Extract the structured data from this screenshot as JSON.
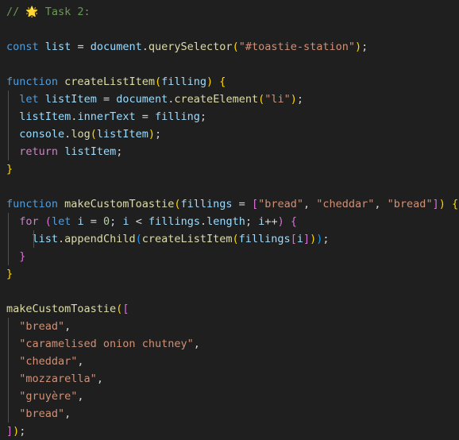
{
  "editor": {
    "language": "javascript",
    "theme": "dark-plus",
    "background_color": "#1f1f1f",
    "colors": {
      "comment": "#6a9955",
      "keyword": "#569cd6",
      "control": "#c586c0",
      "variable": "#9cdcfe",
      "function": "#dcdcaa",
      "string": "#ce9178",
      "number": "#b5cea8",
      "operator": "#d4d4d4",
      "bracket_level_1": "#ffd700",
      "bracket_level_2": "#da70d6",
      "bracket_level_3": "#179fff",
      "indent_guide": "#505050"
    }
  },
  "code": {
    "lines": [
      {
        "n": 1,
        "text": "// 🌟 Task 2:",
        "tokens": [
          {
            "t": "// ",
            "c": "cmt"
          },
          {
            "t": "🌟",
            "c": "star"
          },
          {
            "t": " Task 2:",
            "c": "cmt"
          }
        ]
      },
      {
        "n": 2,
        "text": "",
        "tokens": []
      },
      {
        "n": 3,
        "text": "const list = document.querySelector(\"#toastie-station\");",
        "tokens": [
          {
            "t": "const",
            "c": "kw"
          },
          {
            "t": " ",
            "c": "plain"
          },
          {
            "t": "list",
            "c": "var"
          },
          {
            "t": " ",
            "c": "plain"
          },
          {
            "t": "=",
            "c": "op"
          },
          {
            "t": " ",
            "c": "plain"
          },
          {
            "t": "document",
            "c": "var"
          },
          {
            "t": ".",
            "c": "op"
          },
          {
            "t": "querySelector",
            "c": "fn"
          },
          {
            "t": "(",
            "c": "b1"
          },
          {
            "t": "\"#toastie-station\"",
            "c": "str"
          },
          {
            "t": ")",
            "c": "b1"
          },
          {
            "t": ";",
            "c": "op"
          }
        ]
      },
      {
        "n": 4,
        "text": "",
        "tokens": []
      },
      {
        "n": 5,
        "text": "function createListItem(filling) {",
        "tokens": [
          {
            "t": "function",
            "c": "kw"
          },
          {
            "t": " ",
            "c": "plain"
          },
          {
            "t": "createListItem",
            "c": "fn"
          },
          {
            "t": "(",
            "c": "b1"
          },
          {
            "t": "filling",
            "c": "var"
          },
          {
            "t": ")",
            "c": "b1"
          },
          {
            "t": " ",
            "c": "plain"
          },
          {
            "t": "{",
            "c": "b1"
          }
        ]
      },
      {
        "n": 6,
        "indent": 1,
        "text": "  let listItem = document.createElement(\"li\");",
        "tokens": [
          {
            "t": "  ",
            "c": "plain"
          },
          {
            "t": "let",
            "c": "kw"
          },
          {
            "t": " ",
            "c": "plain"
          },
          {
            "t": "listItem",
            "c": "var"
          },
          {
            "t": " ",
            "c": "plain"
          },
          {
            "t": "=",
            "c": "op"
          },
          {
            "t": " ",
            "c": "plain"
          },
          {
            "t": "document",
            "c": "var"
          },
          {
            "t": ".",
            "c": "op"
          },
          {
            "t": "createElement",
            "c": "fn"
          },
          {
            "t": "(",
            "c": "b1"
          },
          {
            "t": "\"li\"",
            "c": "str"
          },
          {
            "t": ")",
            "c": "b1"
          },
          {
            "t": ";",
            "c": "op"
          }
        ]
      },
      {
        "n": 7,
        "indent": 1,
        "text": "  listItem.innerText = filling;",
        "tokens": [
          {
            "t": "  ",
            "c": "plain"
          },
          {
            "t": "listItem",
            "c": "var"
          },
          {
            "t": ".",
            "c": "op"
          },
          {
            "t": "innerText",
            "c": "var"
          },
          {
            "t": " ",
            "c": "plain"
          },
          {
            "t": "=",
            "c": "op"
          },
          {
            "t": " ",
            "c": "plain"
          },
          {
            "t": "filling",
            "c": "var"
          },
          {
            "t": ";",
            "c": "op"
          }
        ]
      },
      {
        "n": 8,
        "indent": 1,
        "text": "  console.log(listItem);",
        "tokens": [
          {
            "t": "  ",
            "c": "plain"
          },
          {
            "t": "console",
            "c": "var"
          },
          {
            "t": ".",
            "c": "op"
          },
          {
            "t": "log",
            "c": "fn"
          },
          {
            "t": "(",
            "c": "b1"
          },
          {
            "t": "listItem",
            "c": "var"
          },
          {
            "t": ")",
            "c": "b1"
          },
          {
            "t": ";",
            "c": "op"
          }
        ]
      },
      {
        "n": 9,
        "indent": 1,
        "text": "  return listItem;",
        "tokens": [
          {
            "t": "  ",
            "c": "plain"
          },
          {
            "t": "return",
            "c": "ctl"
          },
          {
            "t": " ",
            "c": "plain"
          },
          {
            "t": "listItem",
            "c": "var"
          },
          {
            "t": ";",
            "c": "op"
          }
        ]
      },
      {
        "n": 10,
        "text": "}",
        "tokens": [
          {
            "t": "}",
            "c": "b1"
          }
        ]
      },
      {
        "n": 11,
        "text": "",
        "tokens": []
      },
      {
        "n": 12,
        "text": "function makeCustomToastie(fillings = [\"bread\", \"cheddar\", \"bread\"]) {",
        "tokens": [
          {
            "t": "function",
            "c": "kw"
          },
          {
            "t": " ",
            "c": "plain"
          },
          {
            "t": "makeCustomToastie",
            "c": "fn"
          },
          {
            "t": "(",
            "c": "b1"
          },
          {
            "t": "fillings",
            "c": "var"
          },
          {
            "t": " ",
            "c": "plain"
          },
          {
            "t": "=",
            "c": "op"
          },
          {
            "t": " ",
            "c": "plain"
          },
          {
            "t": "[",
            "c": "b2"
          },
          {
            "t": "\"bread\"",
            "c": "str"
          },
          {
            "t": ", ",
            "c": "op"
          },
          {
            "t": "\"cheddar\"",
            "c": "str"
          },
          {
            "t": ", ",
            "c": "op"
          },
          {
            "t": "\"bread\"",
            "c": "str"
          },
          {
            "t": "]",
            "c": "b2"
          },
          {
            "t": ")",
            "c": "b1"
          },
          {
            "t": " ",
            "c": "plain"
          },
          {
            "t": "{",
            "c": "b1"
          }
        ]
      },
      {
        "n": 13,
        "indent": 1,
        "text": "  for (let i = 0; i < fillings.length; i++) {",
        "tokens": [
          {
            "t": "  ",
            "c": "plain"
          },
          {
            "t": "for",
            "c": "ctl"
          },
          {
            "t": " ",
            "c": "plain"
          },
          {
            "t": "(",
            "c": "b2"
          },
          {
            "t": "let",
            "c": "kw"
          },
          {
            "t": " ",
            "c": "plain"
          },
          {
            "t": "i",
            "c": "var"
          },
          {
            "t": " ",
            "c": "plain"
          },
          {
            "t": "=",
            "c": "op"
          },
          {
            "t": " ",
            "c": "plain"
          },
          {
            "t": "0",
            "c": "num"
          },
          {
            "t": "; ",
            "c": "op"
          },
          {
            "t": "i",
            "c": "var"
          },
          {
            "t": " ",
            "c": "plain"
          },
          {
            "t": "<",
            "c": "op"
          },
          {
            "t": " ",
            "c": "plain"
          },
          {
            "t": "fillings",
            "c": "var"
          },
          {
            "t": ".",
            "c": "op"
          },
          {
            "t": "length",
            "c": "var"
          },
          {
            "t": "; ",
            "c": "op"
          },
          {
            "t": "i",
            "c": "var"
          },
          {
            "t": "++",
            "c": "op"
          },
          {
            "t": ")",
            "c": "b2"
          },
          {
            "t": " ",
            "c": "plain"
          },
          {
            "t": "{",
            "c": "b2"
          }
        ]
      },
      {
        "n": 14,
        "indent": 2,
        "text": "    list.appendChild(createListItem(fillings[i]));",
        "tokens": [
          {
            "t": "    ",
            "c": "plain"
          },
          {
            "t": "list",
            "c": "var"
          },
          {
            "t": ".",
            "c": "op"
          },
          {
            "t": "appendChild",
            "c": "fn"
          },
          {
            "t": "(",
            "c": "b3"
          },
          {
            "t": "createListItem",
            "c": "fn"
          },
          {
            "t": "(",
            "c": "b1"
          },
          {
            "t": "fillings",
            "c": "var"
          },
          {
            "t": "[",
            "c": "b2"
          },
          {
            "t": "i",
            "c": "var"
          },
          {
            "t": "]",
            "c": "b2"
          },
          {
            "t": ")",
            "c": "b1"
          },
          {
            "t": ")",
            "c": "b3"
          },
          {
            "t": ";",
            "c": "op"
          }
        ]
      },
      {
        "n": 15,
        "indent": 1,
        "text": "  }",
        "tokens": [
          {
            "t": "  ",
            "c": "plain"
          },
          {
            "t": "}",
            "c": "b2"
          }
        ]
      },
      {
        "n": 16,
        "text": "}",
        "tokens": [
          {
            "t": "}",
            "c": "b1"
          }
        ]
      },
      {
        "n": 17,
        "text": "",
        "tokens": []
      },
      {
        "n": 18,
        "text": "makeCustomToastie([",
        "tokens": [
          {
            "t": "makeCustomToastie",
            "c": "fn"
          },
          {
            "t": "(",
            "c": "b1"
          },
          {
            "t": "[",
            "c": "b2"
          }
        ]
      },
      {
        "n": 19,
        "indent": 1,
        "text": "  \"bread\",",
        "tokens": [
          {
            "t": "  ",
            "c": "plain"
          },
          {
            "t": "\"bread\"",
            "c": "str"
          },
          {
            "t": ",",
            "c": "op"
          }
        ]
      },
      {
        "n": 20,
        "indent": 1,
        "text": "  \"caramelised onion chutney\",",
        "tokens": [
          {
            "t": "  ",
            "c": "plain"
          },
          {
            "t": "\"caramelised onion chutney\"",
            "c": "str"
          },
          {
            "t": ",",
            "c": "op"
          }
        ]
      },
      {
        "n": 21,
        "indent": 1,
        "text": "  \"cheddar\",",
        "tokens": [
          {
            "t": "  ",
            "c": "plain"
          },
          {
            "t": "\"cheddar\"",
            "c": "str"
          },
          {
            "t": ",",
            "c": "op"
          }
        ]
      },
      {
        "n": 22,
        "indent": 1,
        "text": "  \"mozzarella\",",
        "tokens": [
          {
            "t": "  ",
            "c": "plain"
          },
          {
            "t": "\"mozzarella\"",
            "c": "str"
          },
          {
            "t": ",",
            "c": "op"
          }
        ]
      },
      {
        "n": 23,
        "indent": 1,
        "text": "  \"gruyère\",",
        "tokens": [
          {
            "t": "  ",
            "c": "plain"
          },
          {
            "t": "\"gruyère\"",
            "c": "str"
          },
          {
            "t": ",",
            "c": "op"
          }
        ]
      },
      {
        "n": 24,
        "indent": 1,
        "text": "  \"bread\",",
        "tokens": [
          {
            "t": "  ",
            "c": "plain"
          },
          {
            "t": "\"bread\"",
            "c": "str"
          },
          {
            "t": ",",
            "c": "op"
          }
        ]
      },
      {
        "n": 25,
        "text": "]);",
        "tokens": [
          {
            "t": "]",
            "c": "b2"
          },
          {
            "t": ")",
            "c": "b1"
          },
          {
            "t": ";",
            "c": "op"
          }
        ]
      }
    ]
  }
}
